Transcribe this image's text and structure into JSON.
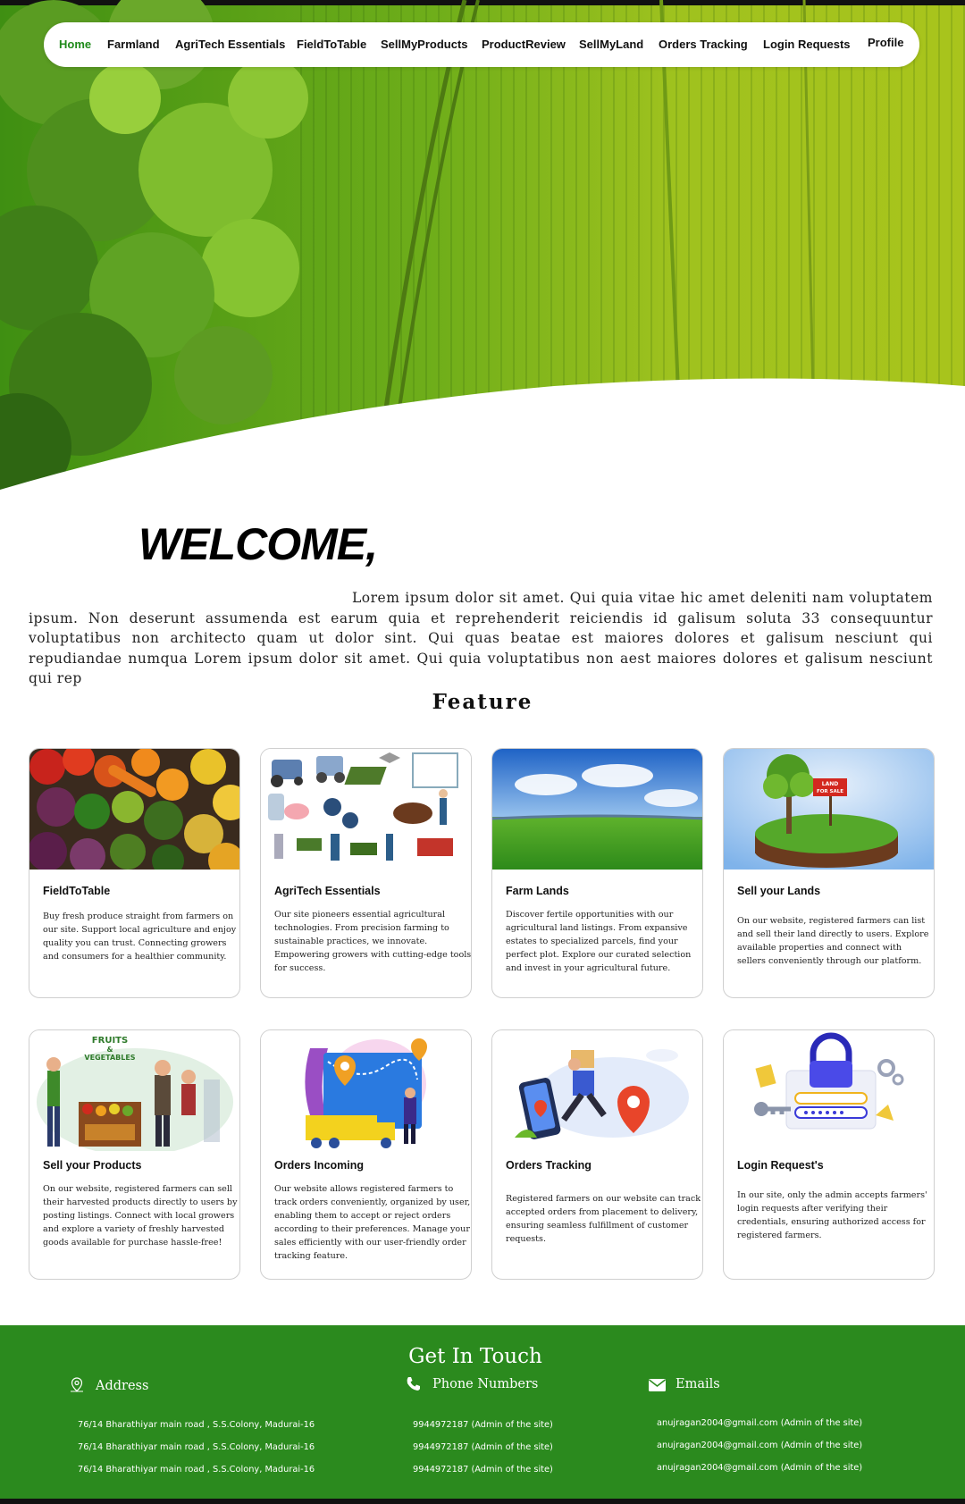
{
  "nav": {
    "items": [
      "Home",
      "Farmland",
      "AgriTech Essentials",
      "FieldToTable",
      "SellMyProducts",
      "ProductReview",
      "SellMyLand",
      "Orders Tracking",
      "Login Requests",
      "Profile"
    ],
    "active": "Home",
    "active_color": "#1f8a1a"
  },
  "welcome": {
    "heading": "WELCOME,",
    "text": "Lorem ipsum dolor sit amet. Qui quia vitae hic amet deleniti nam voluptatem ipsum. Non deserunt assumenda est earum quia et reprehenderit reiciendis id galisum soluta 33 consequuntur voluptatibus non architecto quam ut dolor sint. Qui quas beatae est maiores dolores et galisum nesciunt qui repudiandae numqua Lorem ipsum dolor sit amet. Qui quia voluptatibus non aest  maiores dolores et galisum nesciunt qui rep"
  },
  "feature": {
    "title": "Feature",
    "cards": [
      {
        "title": "FieldToTable",
        "image": "vegetables-photo",
        "desc": "Buy fresh produce straight from farmers on our site. Support local agriculture and enjoy quality you can trust. Connecting growers and consumers for a healthier community."
      },
      {
        "title": "AgriTech Essentials",
        "image": "agritech-isometric-illustration",
        "desc": "Our site pioneers essential agricultural technologies. From precision farming to sustainable practices, we innovate. Empowering growers with cutting-edge tools for success."
      },
      {
        "title": "Farm Lands",
        "image": "green-field-photo",
        "desc": "Discover fertile opportunities with our agricultural land listings. From expansive estates to specialized parcels, find your perfect plot. Explore our curated selection and invest in your agricultural future."
      },
      {
        "title": "Sell your Lands",
        "image": "land-for-sale-illustration",
        "desc": "On our website, registered farmers can list and sell their land directly to users. Explore available properties and connect with sellers conveniently through our platform."
      },
      {
        "title": "Sell your Products",
        "image": "market-stall-illustration",
        "desc": "On our website, registered farmers can sell their harvested products directly to users by posting listings. Connect with local growers and explore a variety of freshly harvested goods available for purchase hassle-free!"
      },
      {
        "title": "Orders Incoming",
        "image": "delivery-truck-map-illustration",
        "desc": "Our website allows registered farmers to track orders conveniently, organized by user, enabling them to accept or reject orders according to their preferences. Manage your sales efficiently with our user-friendly order tracking feature."
      },
      {
        "title": "Orders Tracking",
        "image": "courier-phone-illustration",
        "desc": "Registered farmers on our website can track accepted orders from placement to delivery, ensuring seamless fulfillment of customer requests."
      },
      {
        "title": "Login Request's",
        "image": "padlock-login-illustration",
        "desc": "In our site, only the admin accepts farmers' login requests after verifying their credentials, ensuring authorized access for registered farmers."
      }
    ]
  },
  "fruits_sign": {
    "line1": "FRUITS",
    "line2": "&",
    "line3": "VEGETABLES"
  },
  "land_sign": {
    "line1": "LAND",
    "line2": "FOR SALE"
  },
  "footer": {
    "title": "Get In Touch",
    "background": "#2b8a1e",
    "address": {
      "heading": "Address",
      "icon": "location-pin-icon",
      "lines": [
        "76/14 Bharathiyar main road , S.S.Colony, Madurai-16",
        "76/14 Bharathiyar main road , S.S.Colony, Madurai-16",
        "76/14 Bharathiyar main road , S.S.Colony, Madurai-16"
      ]
    },
    "phone": {
      "heading": "Phone Numbers",
      "icon": "phone-icon",
      "lines": [
        "9944972187  (Admin of the site)",
        "9944972187  (Admin of the site)",
        "9944972187  (Admin of the site)"
      ]
    },
    "email": {
      "heading": "Emails",
      "icon": "envelope-icon",
      "lines": [
        "anujragan2004@gmail.com  (Admin of the site)",
        "anujragan2004@gmail.com  (Admin of the site)",
        "anujragan2004@gmail.com  (Admin of the site)"
      ]
    }
  }
}
